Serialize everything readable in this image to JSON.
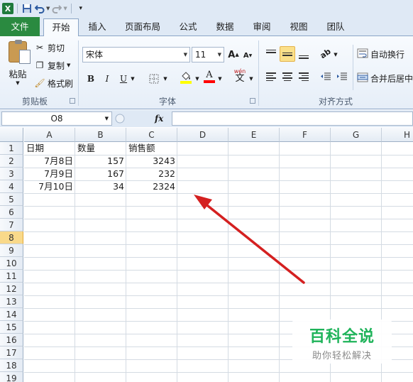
{
  "app": {
    "accent": "#2a8a40"
  },
  "quick_access": {
    "icons": [
      "excel-logo",
      "save-icon",
      "undo-icon",
      "redo-icon",
      "customize-icon"
    ],
    "logo_letter": "X"
  },
  "tabs": [
    {
      "label": "文件"
    },
    {
      "label": "开始",
      "active": true
    },
    {
      "label": "插入"
    },
    {
      "label": "页面布局"
    },
    {
      "label": "公式"
    },
    {
      "label": "数据"
    },
    {
      "label": "审阅"
    },
    {
      "label": "视图"
    },
    {
      "label": "团队"
    }
  ],
  "clipboard": {
    "paste_label": "粘贴",
    "cut_label": "剪切",
    "copy_label": "复制",
    "format_painter_label": "格式刷",
    "group_label": "剪贴板"
  },
  "font": {
    "font_name": "宋体",
    "font_size": "11",
    "group_label": "字体",
    "bold": "B",
    "italic": "I",
    "underline": "U",
    "grow": "A",
    "shrink": "A",
    "font_color": "A",
    "phonetic": "wén",
    "phonetic_char": "文",
    "fill_color": "#ffff00",
    "font_color_hex": "#ff0000"
  },
  "alignment": {
    "wrap_text_label": "自动换行",
    "merge_label": "合并后居中",
    "group_label": "对齐方式"
  },
  "formula_bar": {
    "name_box": "O8",
    "fx_label": "fx",
    "formula": ""
  },
  "sheet": {
    "columns": [
      "A",
      "B",
      "C",
      "D",
      "E",
      "F",
      "G",
      "H"
    ],
    "rows": [
      "1",
      "2",
      "3",
      "4",
      "5",
      "6",
      "7",
      "8",
      "9",
      "10",
      "11",
      "12",
      "13",
      "14",
      "15",
      "16",
      "17",
      "18",
      "19"
    ],
    "selected_row": "8",
    "headers": {
      "a1": "日期",
      "b1": "数量",
      "c1": "销售额"
    },
    "data": [
      {
        "date": "7月8日",
        "qty": "157",
        "sales": "3243"
      },
      {
        "date": "7月9日",
        "qty": "167",
        "sales": "232"
      },
      {
        "date": "7月10日",
        "qty": "34",
        "sales": "2324"
      }
    ]
  },
  "annotation": {
    "arrow_color": "#d42020",
    "icon": "red-arrow"
  },
  "watermark": {
    "title": "百科全说",
    "subtitle": "助你轻松解决"
  }
}
